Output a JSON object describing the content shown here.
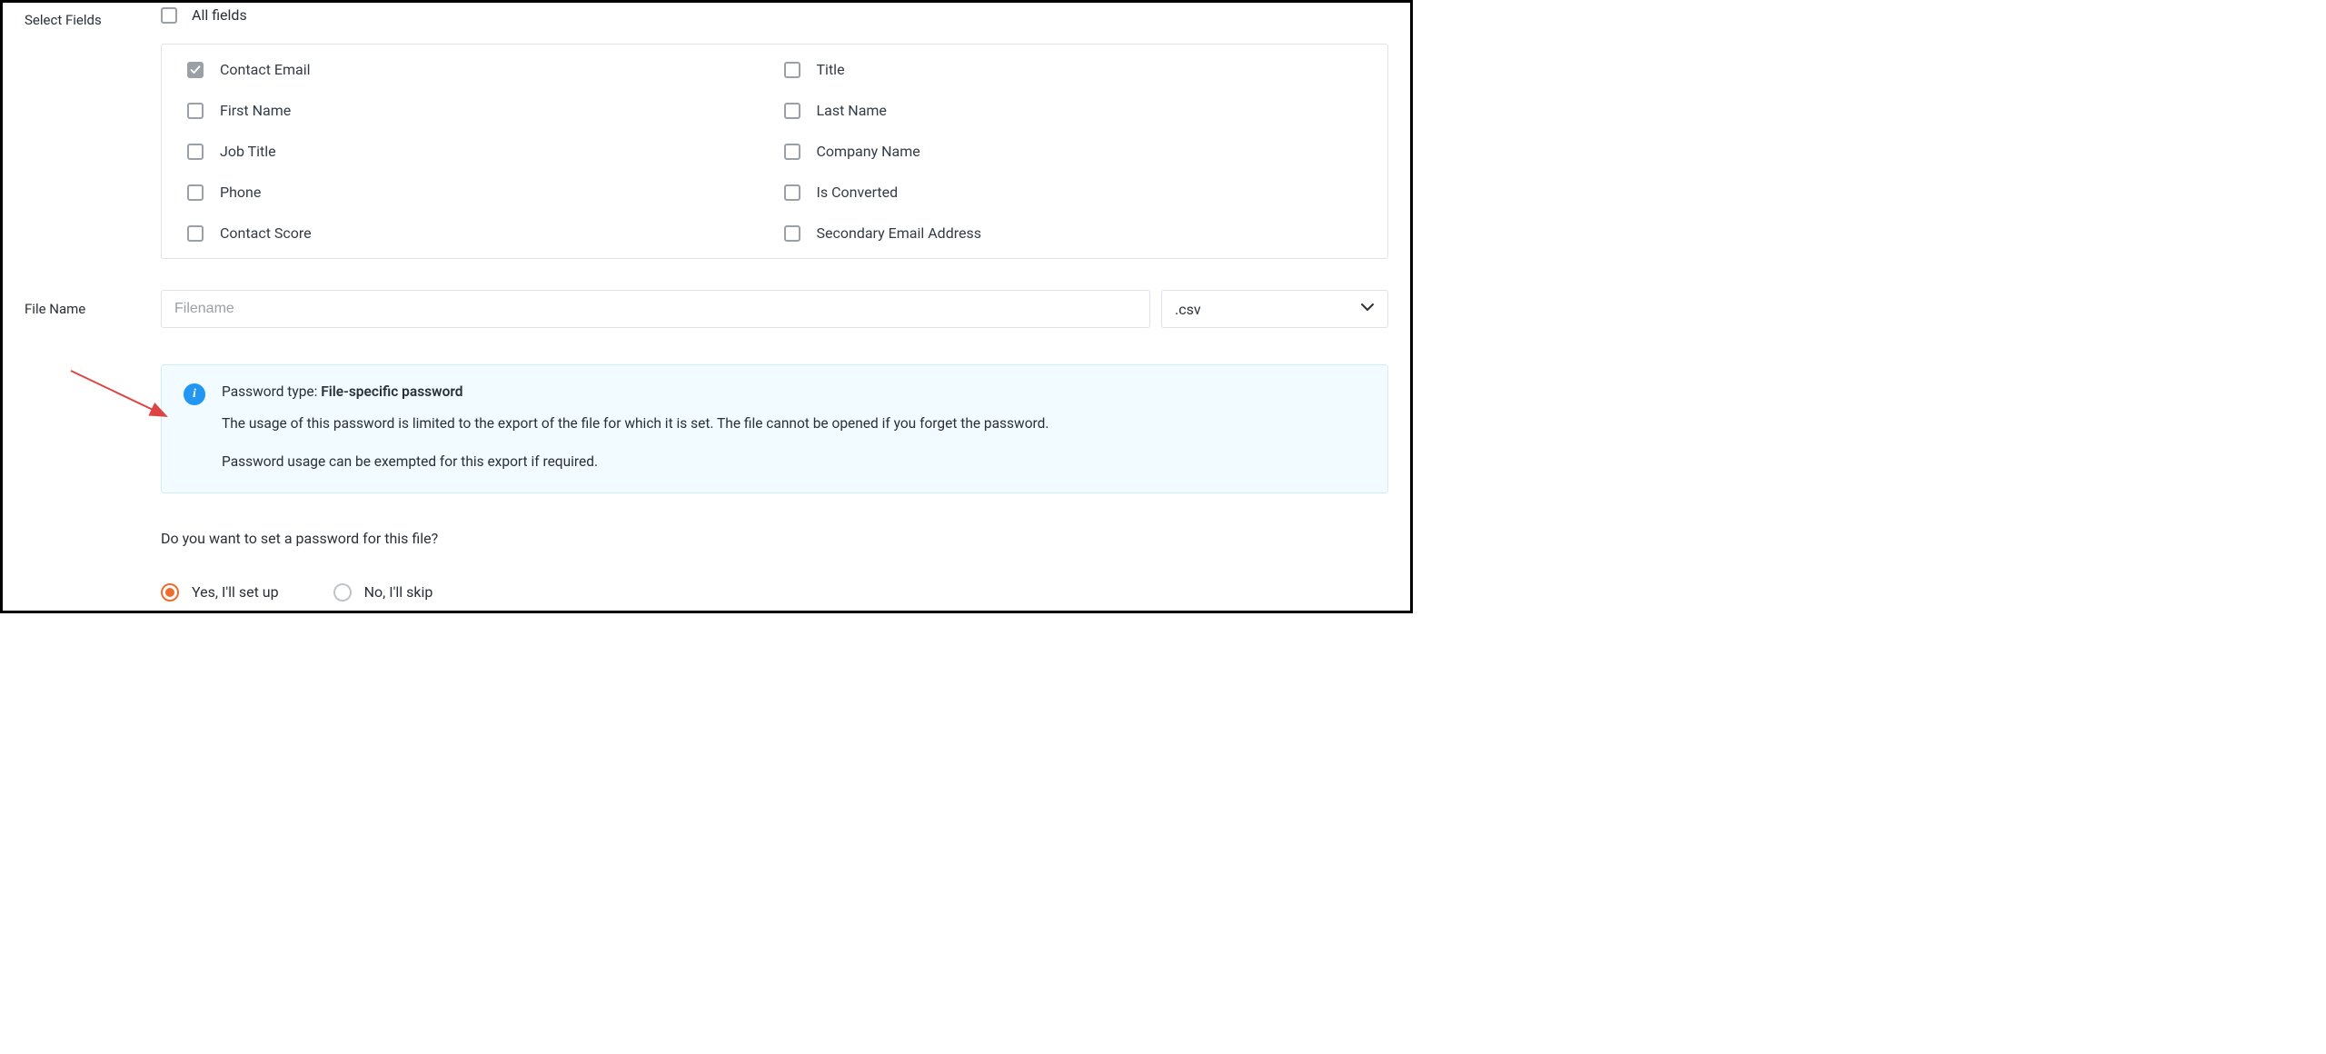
{
  "labels": {
    "select_fields": "Select Fields",
    "all_fields": "All fields",
    "file_name": "File Name"
  },
  "fields": {
    "contact_email": "Contact Email",
    "title": "Title",
    "first_name": "First Name",
    "last_name": "Last Name",
    "job_title": "Job Title",
    "company_name": "Company Name",
    "phone": "Phone",
    "is_converted": "Is Converted",
    "contact_score": "Contact Score",
    "secondary_email": "Secondary Email Address"
  },
  "filename": {
    "placeholder": "Filename",
    "value": "",
    "extension": ".csv"
  },
  "info": {
    "title_prefix": "Password type: ",
    "title_strong": "File-specific password",
    "line1": "The usage of this password is limited to the export of the file for which it is set. The file cannot be opened if you forget the password.",
    "line2": "Password usage can be exempted for this export if required.",
    "icon_glyph": "i"
  },
  "question": "Do you want to set a password for this file?",
  "radios": {
    "yes": "Yes, I'll set up",
    "no": "No, I'll skip"
  }
}
